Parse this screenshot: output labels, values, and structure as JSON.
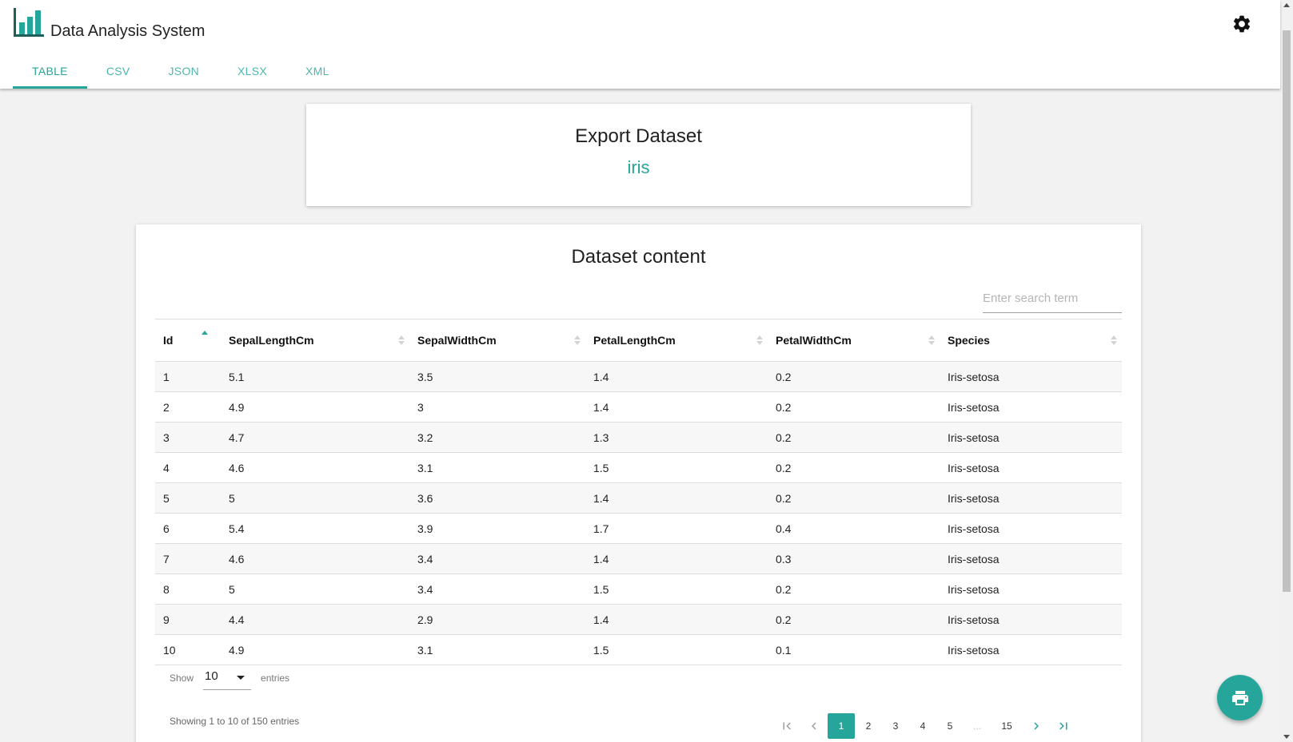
{
  "app": {
    "title": "Data Analysis System"
  },
  "tabs": [
    {
      "label": "TABLE",
      "active": true
    },
    {
      "label": "CSV",
      "active": false
    },
    {
      "label": "JSON",
      "active": false
    },
    {
      "label": "XLSX",
      "active": false
    },
    {
      "label": "XML",
      "active": false
    }
  ],
  "export_card": {
    "title": "Export Dataset",
    "dataset_name": "iris"
  },
  "content_card": {
    "title": "Dataset content",
    "search_placeholder": "Enter search term",
    "columns": [
      "Id",
      "SepalLengthCm",
      "SepalWidthCm",
      "PetalLengthCm",
      "PetalWidthCm",
      "Species"
    ],
    "sorted_column": "Id",
    "sort_direction": "ascending",
    "rows": [
      [
        "1",
        "5.1",
        "3.5",
        "1.4",
        "0.2",
        "Iris-setosa"
      ],
      [
        "2",
        "4.9",
        "3",
        "1.4",
        "0.2",
        "Iris-setosa"
      ],
      [
        "3",
        "4.7",
        "3.2",
        "1.3",
        "0.2",
        "Iris-setosa"
      ],
      [
        "4",
        "4.6",
        "3.1",
        "1.5",
        "0.2",
        "Iris-setosa"
      ],
      [
        "5",
        "5",
        "3.6",
        "1.4",
        "0.2",
        "Iris-setosa"
      ],
      [
        "6",
        "5.4",
        "3.9",
        "1.7",
        "0.4",
        "Iris-setosa"
      ],
      [
        "7",
        "4.6",
        "3.4",
        "1.4",
        "0.3",
        "Iris-setosa"
      ],
      [
        "8",
        "5",
        "3.4",
        "1.5",
        "0.2",
        "Iris-setosa"
      ],
      [
        "9",
        "4.4",
        "2.9",
        "1.4",
        "0.2",
        "Iris-setosa"
      ],
      [
        "10",
        "4.9",
        "3.1",
        "1.5",
        "0.1",
        "Iris-setosa"
      ]
    ],
    "length": {
      "show_label": "Show",
      "value": "10",
      "entries_label": "entries"
    },
    "info": "Showing 1 to 10 of 150 entries",
    "pagination": {
      "pages": [
        "1",
        "2",
        "3",
        "4",
        "5"
      ],
      "ellipsis": "...",
      "last_page": "15",
      "current": "1"
    }
  },
  "colors": {
    "accent": "#26a69a",
    "background": "#f2f2f2"
  },
  "icons": {
    "logo": "bar-chart-icon",
    "settings": "gear-icon",
    "fab": "print-icon"
  }
}
